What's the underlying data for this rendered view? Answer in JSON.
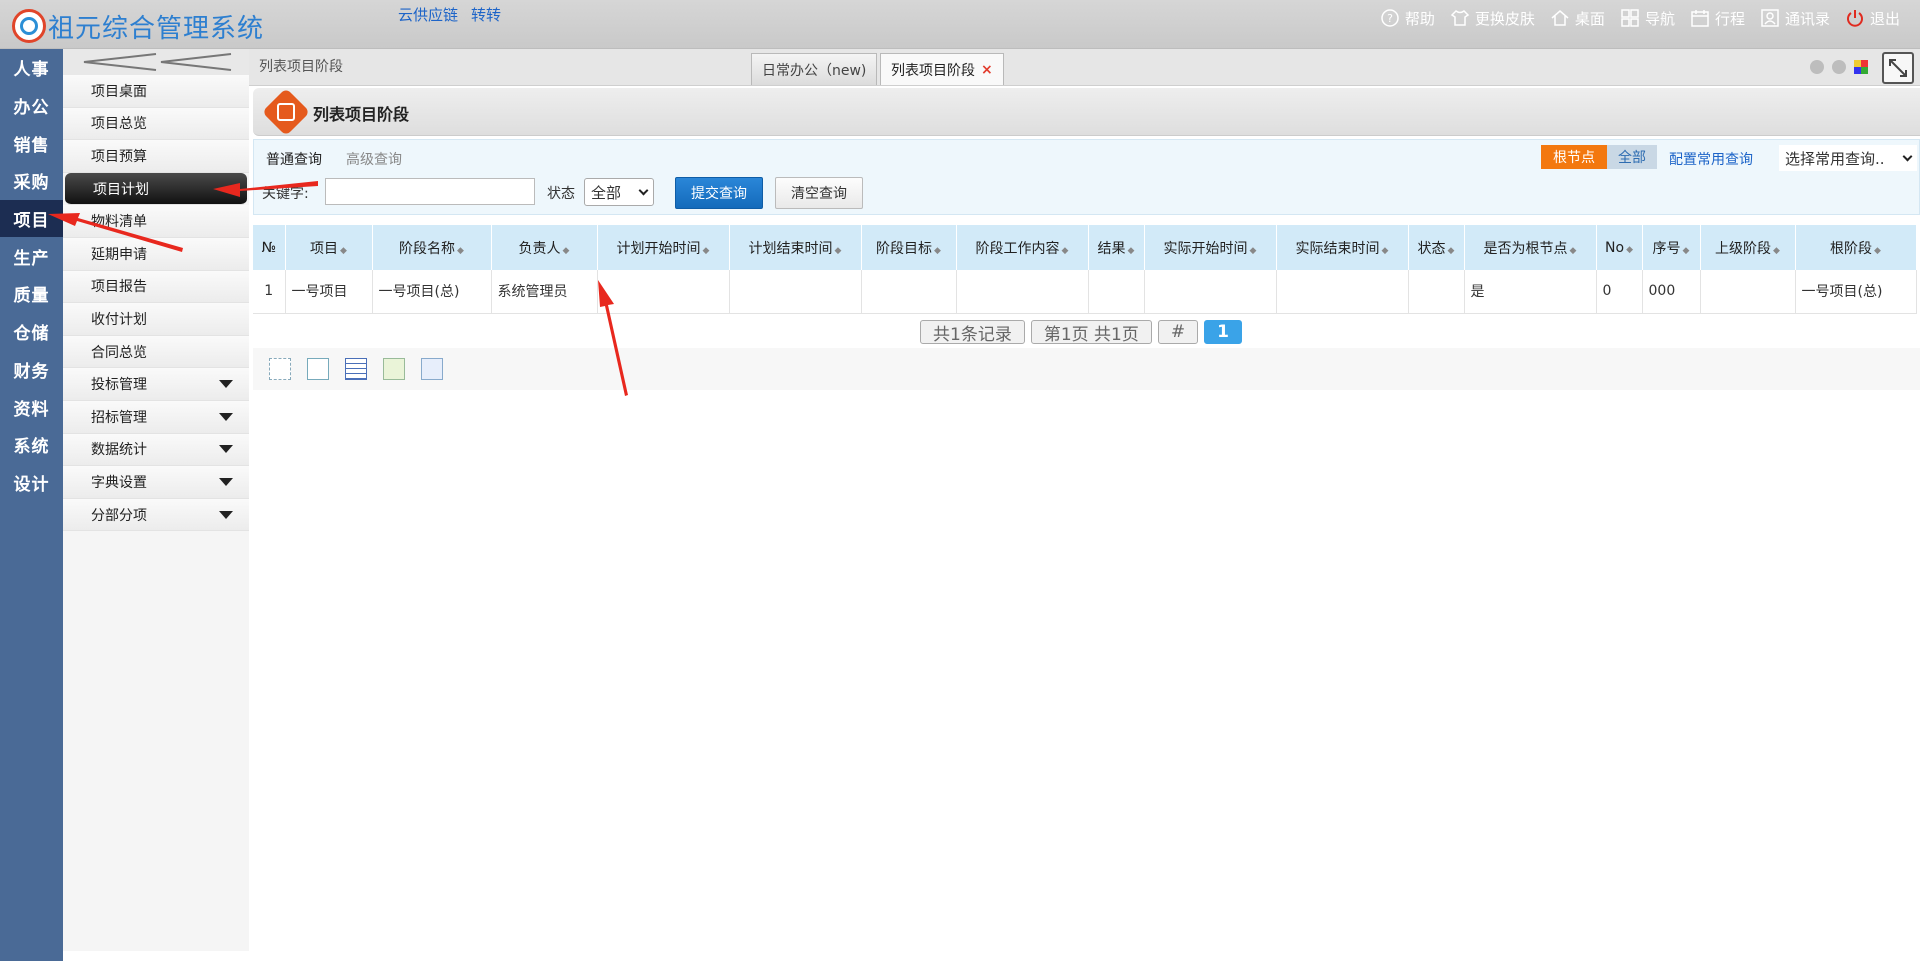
{
  "app": {
    "title": "祖元综合管理系统",
    "top_links": [
      "云供应链",
      "转转"
    ]
  },
  "toolbar": [
    {
      "label": "帮助",
      "icon": "help-icon"
    },
    {
      "label": "更换皮肤",
      "icon": "shirt-icon"
    },
    {
      "label": "桌面",
      "icon": "home-icon"
    },
    {
      "label": "导航",
      "icon": "grid-icon"
    },
    {
      "label": "行程",
      "icon": "calendar-icon"
    },
    {
      "label": "通讯录",
      "icon": "contacts-icon"
    },
    {
      "label": "退出",
      "icon": "power-icon"
    }
  ],
  "leftnav": [
    "人事",
    "办公",
    "销售",
    "采购",
    "项目",
    "生产",
    "质量",
    "仓储",
    "财务",
    "资料",
    "系统",
    "设计"
  ],
  "leftnav_active": "项目",
  "submenu": [
    {
      "label": "项目桌面",
      "has_children": false
    },
    {
      "label": "项目总览",
      "has_children": false
    },
    {
      "label": "项目预算",
      "has_children": false
    },
    {
      "label": "项目计划",
      "has_children": false,
      "active": true
    },
    {
      "label": "物料清单",
      "has_children": false
    },
    {
      "label": "延期申请",
      "has_children": false
    },
    {
      "label": "项目报告",
      "has_children": false
    },
    {
      "label": "收付计划",
      "has_children": false
    },
    {
      "label": "合同总览",
      "has_children": false
    },
    {
      "label": "投标管理",
      "has_children": true
    },
    {
      "label": "招标管理",
      "has_children": true
    },
    {
      "label": "数据统计",
      "has_children": true
    },
    {
      "label": "字典设置",
      "has_children": true
    },
    {
      "label": "分部分项",
      "has_children": true
    }
  ],
  "tabs": {
    "breadcrumb": "列表项目阶段",
    "items": [
      {
        "label": "日常办公（new)",
        "active": false
      },
      {
        "label": "列表项目阶段",
        "active": true,
        "close": "×"
      }
    ]
  },
  "page": {
    "title": "列表项目阶段"
  },
  "query": {
    "tab_normal": "普通查询",
    "tab_advanced": "高级查询",
    "keyword_label": "关键字:",
    "keyword_value": "",
    "status_label": "状态",
    "status_value": "全部",
    "submit": "提交查询",
    "clear": "清空查询",
    "root_node": "根节点",
    "all": "全部",
    "config_common": "配置常用查询",
    "common_select": "选择常用查询.."
  },
  "table": {
    "columns": [
      "№",
      "项目",
      "阶段名称",
      "负责人",
      "计划开始时间",
      "计划结束时间",
      "阶段目标",
      "阶段工作内容",
      "结果",
      "实际开始时间",
      "实际结束时间",
      "状态",
      "是否为根节点",
      "No",
      "序号",
      "上级阶段",
      "根阶段"
    ],
    "sortable": [
      false,
      true,
      true,
      true,
      true,
      true,
      true,
      true,
      true,
      true,
      true,
      true,
      true,
      true,
      true,
      true,
      true
    ],
    "rows": [
      [
        "1",
        "一号项目",
        "一号项目(总)",
        "系统管理员",
        "",
        "",
        "",
        "",
        "",
        "",
        "",
        "",
        "是",
        "0",
        "000",
        "",
        "一号项目(总)"
      ]
    ]
  },
  "pager": {
    "total": "共1条记录",
    "page_info": "第1页 共1页",
    "jump": "#",
    "current": "1"
  },
  "colors": {
    "nav_bg": "#4a6a96",
    "nav_active": "#1c2d52",
    "accent_orange": "#f3780f",
    "submit_blue": "#1a74c6",
    "header_blue": "#d2eaf8",
    "arrow_red": "#e8281e"
  }
}
